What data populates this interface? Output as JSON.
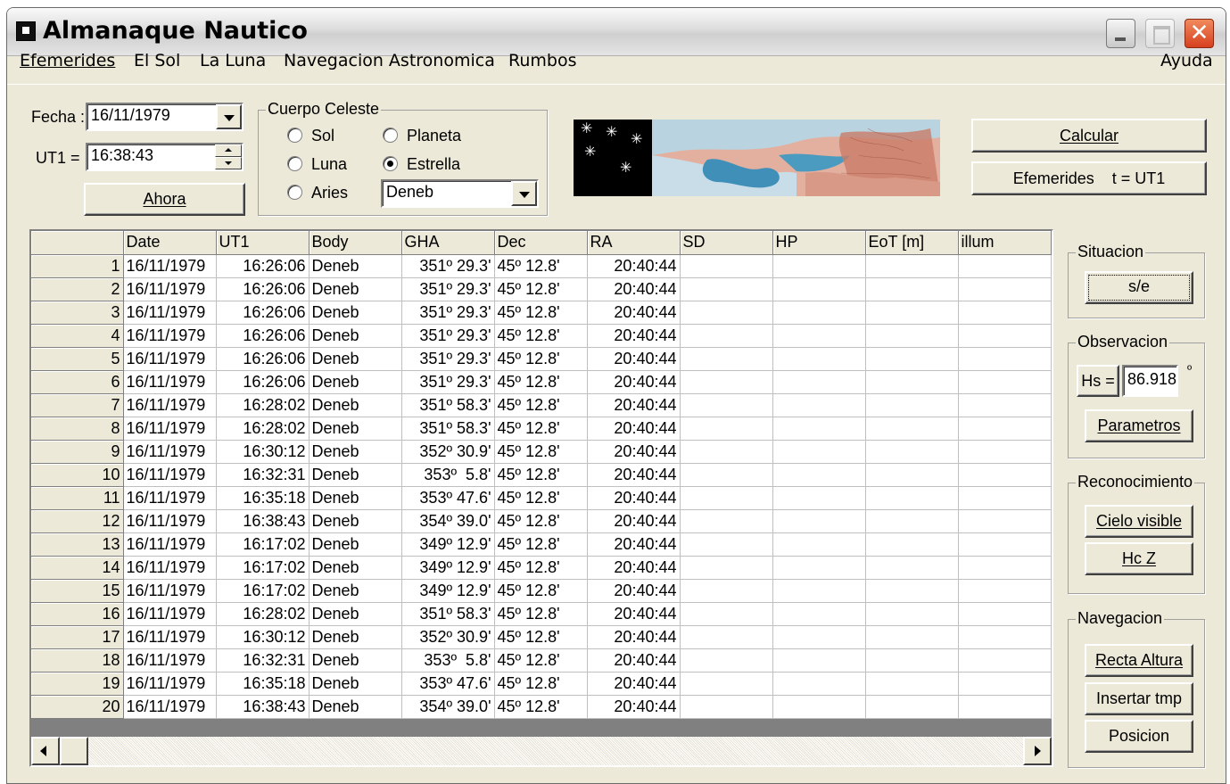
{
  "window": {
    "title": "Almanaque Nautico"
  },
  "menu": [
    "Efemerides",
    "El Sol",
    "La Luna",
    "Navegacion Astronomica",
    "Rumbos",
    "Ayuda"
  ],
  "fecha": {
    "label": "Fecha :",
    "value": "16/11/1979"
  },
  "ut1": {
    "label": "UT1 =",
    "value": "16:38:43"
  },
  "ahora_button": "Ahora",
  "cuerpo_celeste": {
    "title": "Cuerpo Celeste",
    "options": [
      "Sol",
      "Luna",
      "Aries",
      "Planeta",
      "Estrella"
    ],
    "selected": "Estrella",
    "star_select": "Deneb"
  },
  "buttons": {
    "calcular": "Calcular",
    "efemerides": "Efemerides    t = UT1"
  },
  "table": {
    "columns": [
      "",
      "Date",
      "UT1",
      "Body",
      "GHA",
      "Dec",
      "RA",
      "SD",
      "HP",
      "EoT [m]",
      "illum"
    ],
    "rows": [
      [
        "1",
        "16/11/1979",
        "16:26:06",
        "Deneb",
        "351º 29.3'",
        "45º 12.8'",
        "20:40:44",
        "",
        "",
        "",
        ""
      ],
      [
        "2",
        "16/11/1979",
        "16:26:06",
        "Deneb",
        "351º 29.3'",
        "45º 12.8'",
        "20:40:44",
        "",
        "",
        "",
        ""
      ],
      [
        "3",
        "16/11/1979",
        "16:26:06",
        "Deneb",
        "351º 29.3'",
        "45º 12.8'",
        "20:40:44",
        "",
        "",
        "",
        ""
      ],
      [
        "4",
        "16/11/1979",
        "16:26:06",
        "Deneb",
        "351º 29.3'",
        "45º 12.8'",
        "20:40:44",
        "",
        "",
        "",
        ""
      ],
      [
        "5",
        "16/11/1979",
        "16:26:06",
        "Deneb",
        "351º 29.3'",
        "45º 12.8'",
        "20:40:44",
        "",
        "",
        "",
        ""
      ],
      [
        "6",
        "16/11/1979",
        "16:26:06",
        "Deneb",
        "351º 29.3'",
        "45º 12.8'",
        "20:40:44",
        "",
        "",
        "",
        ""
      ],
      [
        "7",
        "16/11/1979",
        "16:28:02",
        "Deneb",
        "351º 58.3'",
        "45º 12.8'",
        "20:40:44",
        "",
        "",
        "",
        ""
      ],
      [
        "8",
        "16/11/1979",
        "16:28:02",
        "Deneb",
        "351º 58.3'",
        "45º 12.8'",
        "20:40:44",
        "",
        "",
        "",
        ""
      ],
      [
        "9",
        "16/11/1979",
        "16:30:12",
        "Deneb",
        "352º 30.9'",
        "45º 12.8'",
        "20:40:44",
        "",
        "",
        "",
        ""
      ],
      [
        "10",
        "16/11/1979",
        "16:32:31",
        "Deneb",
        "353º  5.8'",
        "45º 12.8'",
        "20:40:44",
        "",
        "",
        "",
        ""
      ],
      [
        "11",
        "16/11/1979",
        "16:35:18",
        "Deneb",
        "353º 47.6'",
        "45º 12.8'",
        "20:40:44",
        "",
        "",
        "",
        ""
      ],
      [
        "12",
        "16/11/1979",
        "16:38:43",
        "Deneb",
        "354º 39.0'",
        "45º 12.8'",
        "20:40:44",
        "",
        "",
        "",
        ""
      ],
      [
        "13",
        "16/11/1979",
        "16:17:02",
        "Deneb",
        "349º 12.9'",
        "45º 12.8'",
        "20:40:44",
        "",
        "",
        "",
        ""
      ],
      [
        "14",
        "16/11/1979",
        "16:17:02",
        "Deneb",
        "349º 12.9'",
        "45º 12.8'",
        "20:40:44",
        "",
        "",
        "",
        ""
      ],
      [
        "15",
        "16/11/1979",
        "16:17:02",
        "Deneb",
        "349º 12.9'",
        "45º 12.8'",
        "20:40:44",
        "",
        "",
        "",
        ""
      ],
      [
        "16",
        "16/11/1979",
        "16:28:02",
        "Deneb",
        "351º 58.3'",
        "45º 12.8'",
        "20:40:44",
        "",
        "",
        "",
        ""
      ],
      [
        "17",
        "16/11/1979",
        "16:30:12",
        "Deneb",
        "352º 30.9'",
        "45º 12.8'",
        "20:40:44",
        "",
        "",
        "",
        ""
      ],
      [
        "18",
        "16/11/1979",
        "16:32:31",
        "Deneb",
        "353º  5.8'",
        "45º 12.8'",
        "20:40:44",
        "",
        "",
        "",
        ""
      ],
      [
        "19",
        "16/11/1979",
        "16:35:18",
        "Deneb",
        "353º 47.6'",
        "45º 12.8'",
        "20:40:44",
        "",
        "",
        "",
        ""
      ],
      [
        "20",
        "16/11/1979",
        "16:38:43",
        "Deneb",
        "354º 39.0'",
        "45º 12.8'",
        "20:40:44",
        "",
        "",
        "",
        ""
      ]
    ]
  },
  "situacion": {
    "title": "Situacion",
    "button": "s/e"
  },
  "observacion": {
    "title": "Observacion",
    "hs_button": "Hs =",
    "hs_value": "86.918",
    "unit": "º",
    "parametros": "Parametros"
  },
  "reconocimiento": {
    "title": "Reconocimiento",
    "cielo_visible": "Cielo visible",
    "hcz": "Hc Z"
  },
  "navegacion": {
    "title": "Navegacion",
    "recta_altura": "Recta Altura",
    "insertar_tmp": "Insertar tmp",
    "posicion": "Posicion"
  },
  "colors": {
    "titlebar": "#dcdcdc",
    "face": "#ece9d8",
    "close": "#d7401e",
    "sky": "#000000",
    "map_land": "#d98c7a",
    "map_sea": "#4a9bbf"
  }
}
